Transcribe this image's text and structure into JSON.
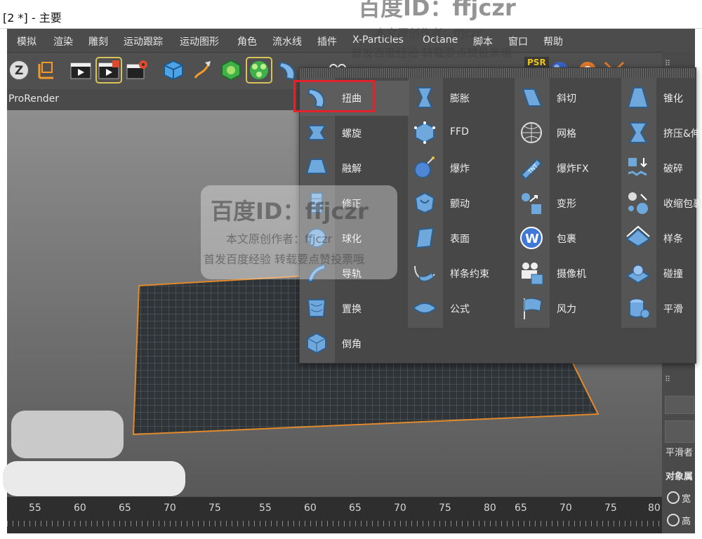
{
  "window": {
    "title": "[2 *] - 主要"
  },
  "menubar": {
    "items": [
      "模拟",
      "渲染",
      "雕刻",
      "运动跟踪",
      "运动图形",
      "角色",
      "流水线",
      "插件",
      "X-Particles",
      "Octane",
      "脚本",
      "窗口",
      "帮助"
    ]
  },
  "toolbar": {
    "psr_label": "PSR"
  },
  "viewport": {
    "header_label": "ProRender"
  },
  "deformer_menu": {
    "columns": [
      [
        "扭曲",
        "螺旋",
        "融解",
        "修正",
        "球化",
        "导轨",
        "置换",
        "倒角"
      ],
      [
        "膨胀",
        "FFD",
        "爆炸",
        "颤动",
        "表面",
        "样条约束",
        "公式"
      ],
      [
        "斜切",
        "网格",
        "爆炸FX",
        "变形",
        "包裹",
        "摄像机",
        "风力"
      ],
      [
        "锥化",
        "挤压&伸",
        "破碎",
        "收缩包裹",
        "样条",
        "碰撞",
        "平滑"
      ]
    ],
    "highlighted": "扭曲"
  },
  "right_panel": {
    "smooth_label": "平滑者",
    "object_label": "对象属",
    "radio_1": "宽",
    "radio_2": "高"
  },
  "timeline": {
    "ticks": [
      "55",
      "60",
      "65",
      "70",
      "75",
      "55",
      "60",
      "65",
      "70",
      "75",
      "80",
      "65",
      "70",
      "75",
      "80"
    ]
  },
  "watermark": {
    "line1": "百度ID：ffjczr",
    "line2": "本文原创作者：ffjczr",
    "line3": "首发百度经验  转载要点赞投票哦"
  },
  "colors": {
    "highlight_border": "#e3232a",
    "mesh": "#2f3438",
    "mesh_edge": "#e08a2c"
  }
}
